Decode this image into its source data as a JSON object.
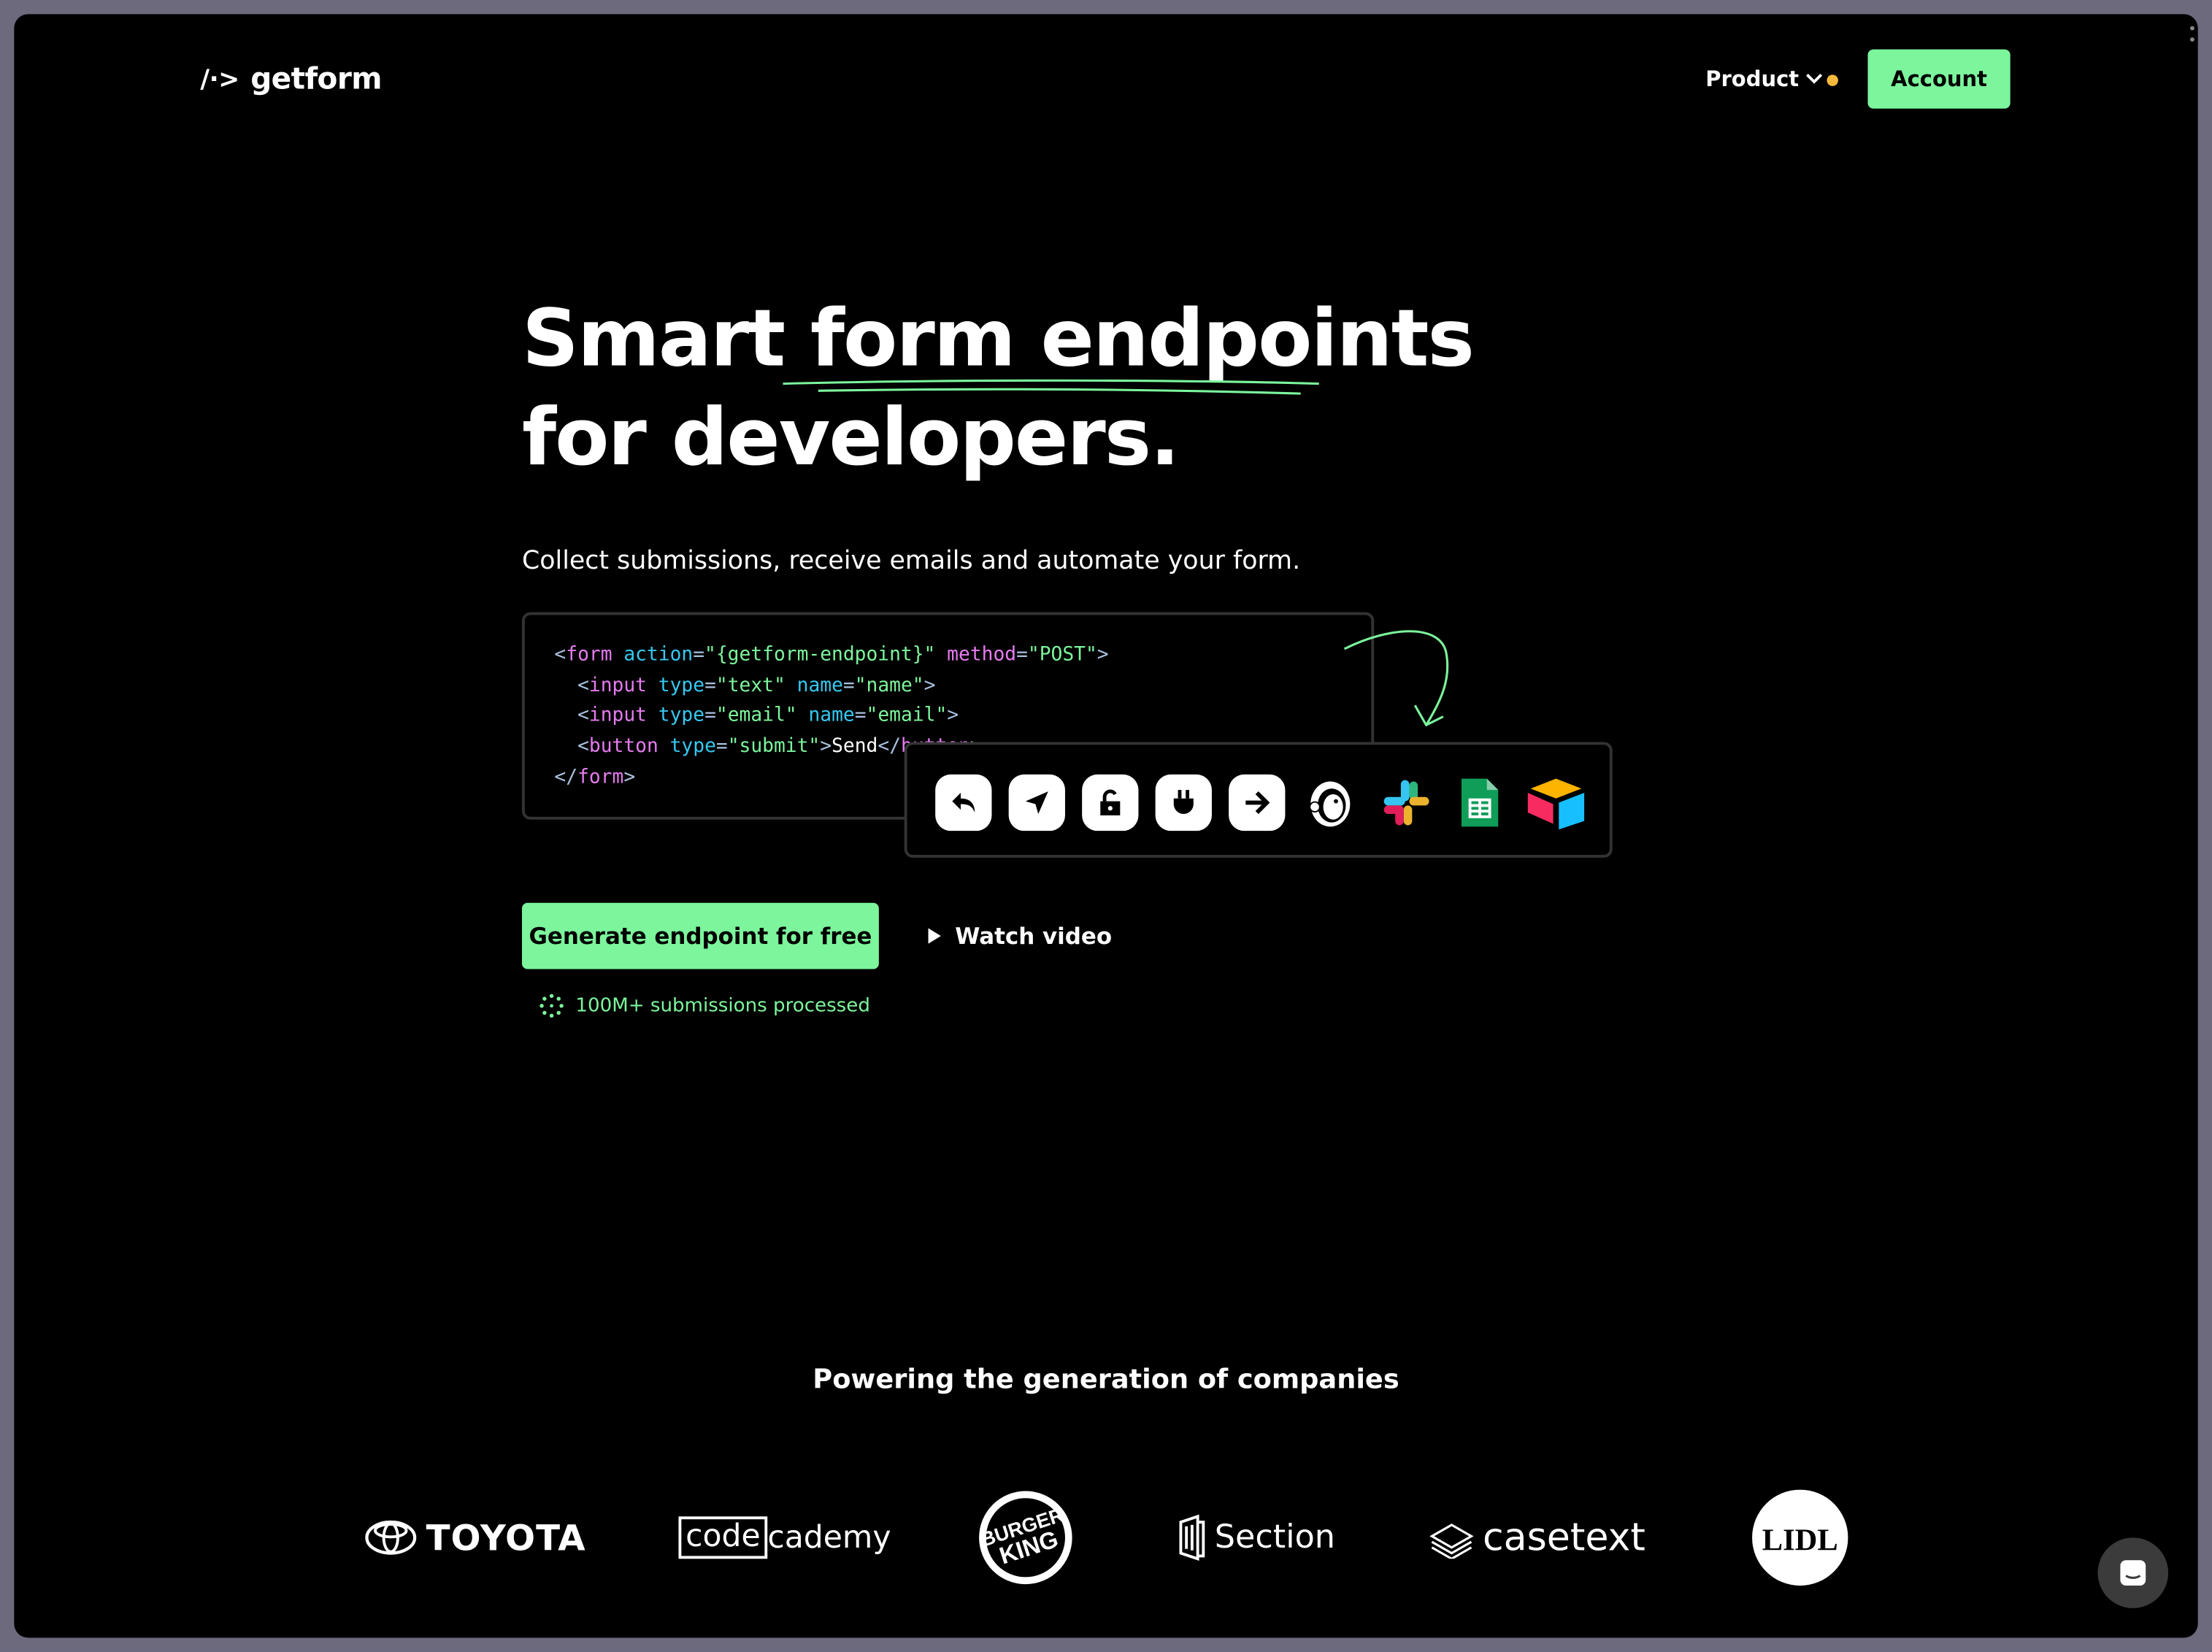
{
  "colors": {
    "accent": "#7cf59c",
    "background": "#000000",
    "notification_dot": "#f6b93b",
    "code_tag": "#e67bf0",
    "code_attr": "#36c8f0",
    "code_string": "#7cf59c"
  },
  "nav": {
    "logo_mark": "/·>",
    "logo_text": "getform",
    "product_label": "Product",
    "account_label": "Account"
  },
  "hero": {
    "headline_line1_a": "Smart ",
    "headline_line1_b": "form endpoints",
    "headline_line2": "for developers.",
    "subtitle": "Collect submissions, receive emails and automate your form.",
    "code_lines": [
      [
        [
          "b",
          "<"
        ],
        [
          "tag",
          "form "
        ],
        [
          "attr",
          "action"
        ],
        [
          "b",
          "="
        ],
        [
          "str",
          "\"{getform-endpoint}\" "
        ],
        [
          "tag",
          "method"
        ],
        [
          "b",
          "="
        ],
        [
          "str",
          "\"POST\""
        ],
        [
          "b",
          ">"
        ]
      ],
      [
        [
          "txt",
          "  "
        ],
        [
          "b",
          "<"
        ],
        [
          "tag",
          "input "
        ],
        [
          "attr",
          "type"
        ],
        [
          "b",
          "="
        ],
        [
          "str",
          "\"text\" "
        ],
        [
          "attr",
          "name"
        ],
        [
          "b",
          "="
        ],
        [
          "str",
          "\"name\""
        ],
        [
          "b",
          ">"
        ]
      ],
      [
        [
          "txt",
          "  "
        ],
        [
          "b",
          "<"
        ],
        [
          "tag",
          "input "
        ],
        [
          "attr",
          "type"
        ],
        [
          "b",
          "="
        ],
        [
          "str",
          "\"email\" "
        ],
        [
          "attr",
          "name"
        ],
        [
          "b",
          "="
        ],
        [
          "str",
          "\"email\""
        ],
        [
          "b",
          ">"
        ]
      ],
      [
        [
          "txt",
          "  "
        ],
        [
          "b",
          "<"
        ],
        [
          "tag",
          "button "
        ],
        [
          "attr",
          "type"
        ],
        [
          "b",
          "="
        ],
        [
          "str",
          "\"submit\""
        ],
        [
          "b",
          ">"
        ],
        [
          "txt",
          "Send"
        ],
        [
          "b",
          "</"
        ],
        [
          "tag",
          "button"
        ],
        [
          "b",
          ">"
        ]
      ],
      [
        [
          "b",
          "</"
        ],
        [
          "tag",
          "form"
        ],
        [
          "b",
          ">"
        ]
      ]
    ],
    "integrations": [
      "reply-icon",
      "send-icon",
      "lock-icon",
      "plug-icon",
      "arrow-right-icon",
      "mailchimp-icon",
      "slack-icon",
      "google-sheets-icon",
      "airtable-icon"
    ],
    "cta_label": "Generate endpoint for free",
    "watch_label": "Watch video",
    "stat_label": "100M+ submissions processed"
  },
  "companies": {
    "title": "Powering the generation of companies",
    "logos": [
      "TOYOTA",
      "codecademy",
      "Burger King",
      "Section",
      "casetext",
      "Lidl"
    ]
  }
}
